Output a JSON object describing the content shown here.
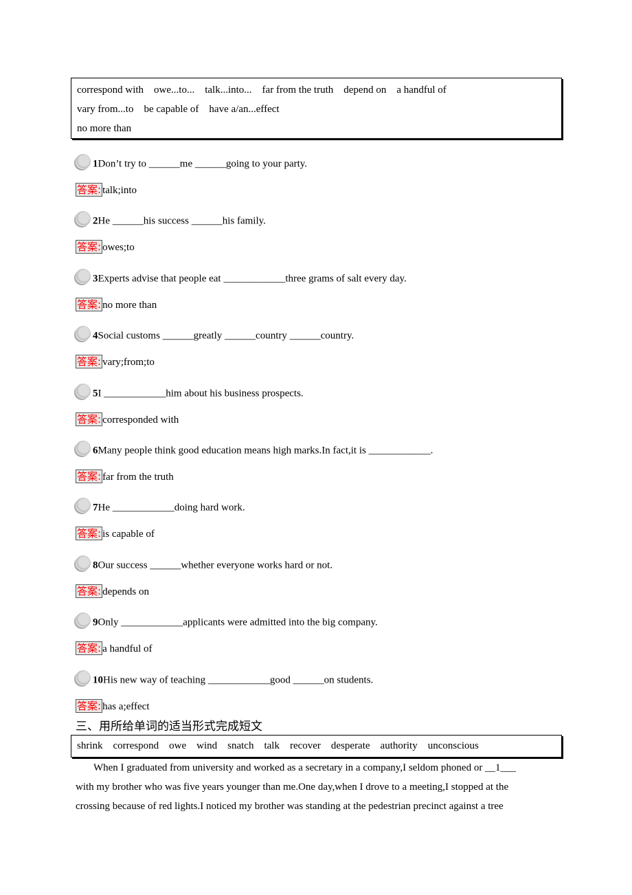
{
  "phrase_box": {
    "lines": [
      "correspond with    owe...to...    talk...into...    far from the truth    depend on    a handful of",
      "vary from...to    be capable of    have a/an...effect",
      "no more than"
    ]
  },
  "answer_tag": "答案:",
  "questions": [
    {
      "num": "1",
      "text": "Don’t try to ______me ______going to your party.",
      "answer": "talk;into"
    },
    {
      "num": "2",
      "text": "He ______his success ______his family.",
      "answer": "owes;to"
    },
    {
      "num": "3",
      "text": "Experts advise that people eat ____________three grams of salt every day.",
      "answer": "no more than"
    },
    {
      "num": "4",
      "text": "Social customs ______greatly ______country ______country.",
      "answer": "vary;from;to"
    },
    {
      "num": "5",
      "text": "I ____________him about his business prospects.",
      "answer": "corresponded with"
    },
    {
      "num": "6",
      "text": "Many people think good education means high marks.In fact,it is ____________.",
      "answer": "far from the truth"
    },
    {
      "num": "7",
      "text": "He ____________doing hard work.",
      "answer": "is capable of"
    },
    {
      "num": "8",
      "text": "Our success ______whether everyone works hard or not.",
      "answer": "depends on"
    },
    {
      "num": "9",
      "text": "Only ____________applicants were admitted into the big company.",
      "answer": "a handful of"
    },
    {
      "num": "10",
      "text": "His new way of teaching ____________good ______on students.",
      "answer": "has a;effect"
    }
  ],
  "section3": {
    "heading": "三、用所给单词的适当形式完成短文",
    "words": "shrink    correspond    owe    wind    snatch    talk    recover    desperate    authority    unconscious",
    "paragraph": [
      "       When I graduated from university and worked as a secretary in a company,I seldom phoned or __1___",
      "with my brother who was five years younger than me.One day,when I drove to a meeting,I stopped at the",
      "crossing because of red lights.I noticed my brother was standing at the pedestrian precinct against a tree"
    ]
  }
}
